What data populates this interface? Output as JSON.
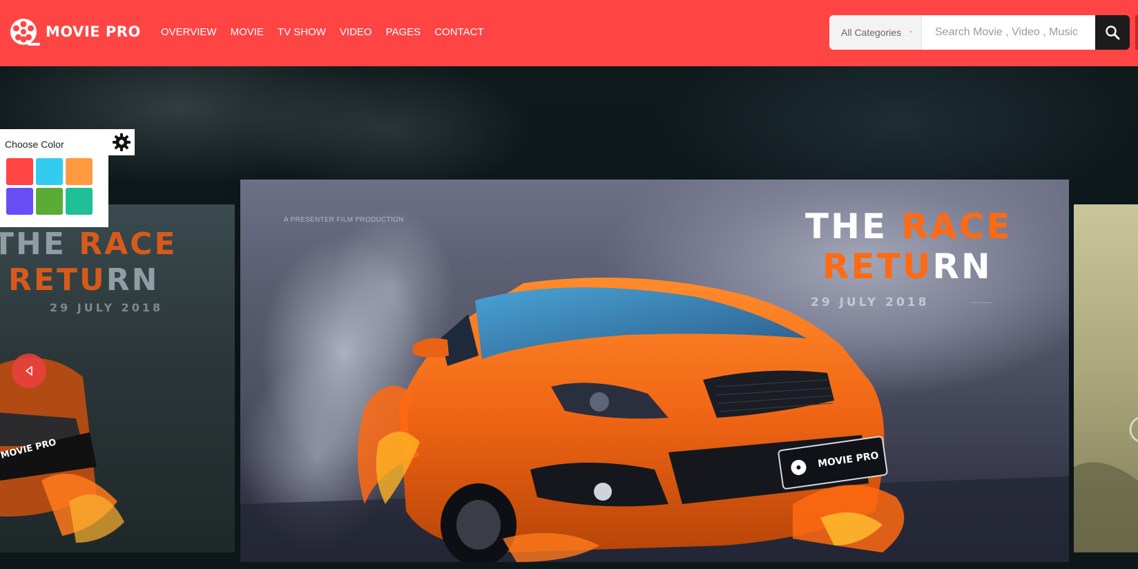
{
  "brand": {
    "name": "MOVIE PRO",
    "accent": "#ff4444"
  },
  "nav": {
    "items": [
      "OVERVIEW",
      "MOVIE",
      "TV SHOW",
      "VIDEO",
      "PAGES",
      "CONTACT"
    ]
  },
  "search": {
    "category": "All Categories",
    "placeholder": "Search Movie , Video , Music",
    "value": "",
    "button_icon": "search-icon"
  },
  "color_chooser": {
    "label": "Choose Color",
    "settings_icon": "gear-icon",
    "swatches": [
      "#ff4444",
      "#33ccf0",
      "#ff9a40",
      "#6a4ef5",
      "#5aac36",
      "#1fbf98"
    ]
  },
  "slider": {
    "prev_icon": "chevron-left-icon",
    "main_slide": {
      "presenter": "A PRESENTER FILM PRODUCTION",
      "title_line1_a": "THE ",
      "title_line1_b": "RACE",
      "title_line2_a": "RETU",
      "title_line2_b": "RN",
      "date": "29 JULY 2018",
      "plate": "MOVIE PRO"
    },
    "side_slide": {
      "title_line1_a": "THE ",
      "title_line1_b": "RACE",
      "title_line2_a": "RETU",
      "title_line2_b": "RN",
      "date": "29 JULY 2018",
      "plate": "MOVIE PRO"
    }
  }
}
